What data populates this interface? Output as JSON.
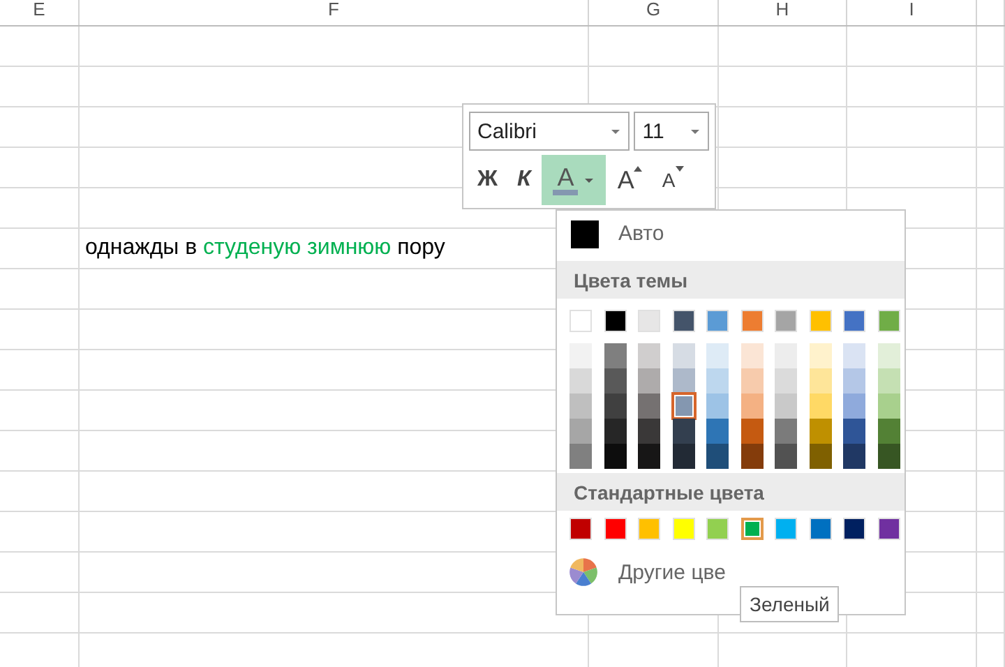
{
  "columns": [
    "E",
    "F",
    "G",
    "H",
    "I",
    ""
  ],
  "cell_text": [
    {
      "text": "однажды в ",
      "color": "#000000"
    },
    {
      "text": "студеную зимнюю",
      "color": "#00b050"
    },
    {
      "text": " пору",
      "color": "#000000"
    }
  ],
  "mini_toolbar": {
    "font": "Calibri",
    "size": "11",
    "bold": "Ж",
    "italic": "К",
    "font_color": {
      "glyph": "A",
      "color": "#8497b0",
      "selected": true
    },
    "grow": "A",
    "shrink": "A"
  },
  "color_menu": {
    "auto": {
      "label": "Авто",
      "color": "#000000"
    },
    "theme_heading": "Цвета темы",
    "theme_top": [
      {
        "color": "#ffffff",
        "selected": false
      },
      {
        "color": "#000000",
        "selected": false
      },
      {
        "color": "#e7e6e6",
        "selected": false
      },
      {
        "color": "#44546a",
        "selected": false
      },
      {
        "color": "#5b9bd5",
        "selected": false
      },
      {
        "color": "#ed7d31",
        "selected": false
      },
      {
        "color": "#a5a5a5",
        "selected": false
      },
      {
        "color": "#ffc000",
        "selected": false
      },
      {
        "color": "#4472c4",
        "selected": false
      },
      {
        "color": "#70ad47",
        "selected": false
      }
    ],
    "theme_shades": [
      [
        {
          "color": "#f2f2f2",
          "selected": false
        },
        {
          "color": "#d9d9d9",
          "selected": false
        },
        {
          "color": "#bfbfbf",
          "selected": false
        },
        {
          "color": "#a6a6a6",
          "selected": false
        },
        {
          "color": "#808080",
          "selected": false
        }
      ],
      [
        {
          "color": "#7f7f7f",
          "selected": false
        },
        {
          "color": "#595959",
          "selected": false
        },
        {
          "color": "#404040",
          "selected": false
        },
        {
          "color": "#262626",
          "selected": false
        },
        {
          "color": "#0d0d0d",
          "selected": false
        }
      ],
      [
        {
          "color": "#d0cece",
          "selected": false
        },
        {
          "color": "#aeabab",
          "selected": false
        },
        {
          "color": "#757171",
          "selected": false
        },
        {
          "color": "#3a3838",
          "selected": false
        },
        {
          "color": "#171616",
          "selected": false
        }
      ],
      [
        {
          "color": "#d6dce4",
          "selected": false
        },
        {
          "color": "#adb9ca",
          "selected": false
        },
        {
          "color": "#8497b0",
          "selected": true
        },
        {
          "color": "#333f4f",
          "selected": false
        },
        {
          "color": "#222a35",
          "selected": false
        }
      ],
      [
        {
          "color": "#deebf6",
          "selected": false
        },
        {
          "color": "#bdd7ee",
          "selected": false
        },
        {
          "color": "#9dc3e6",
          "selected": false
        },
        {
          "color": "#2e75b5",
          "selected": false
        },
        {
          "color": "#1f4e79",
          "selected": false
        }
      ],
      [
        {
          "color": "#fbe5d5",
          "selected": false
        },
        {
          "color": "#f7cbac",
          "selected": false
        },
        {
          "color": "#f4b183",
          "selected": false
        },
        {
          "color": "#c55a11",
          "selected": false
        },
        {
          "color": "#843c0b",
          "selected": false
        }
      ],
      [
        {
          "color": "#ededed",
          "selected": false
        },
        {
          "color": "#dbdbdb",
          "selected": false
        },
        {
          "color": "#c9c9c9",
          "selected": false
        },
        {
          "color": "#7b7b7b",
          "selected": false
        },
        {
          "color": "#525252",
          "selected": false
        }
      ],
      [
        {
          "color": "#fff2cc",
          "selected": false
        },
        {
          "color": "#fee599",
          "selected": false
        },
        {
          "color": "#ffd965",
          "selected": false
        },
        {
          "color": "#bf9000",
          "selected": false
        },
        {
          "color": "#7f6000",
          "selected": false
        }
      ],
      [
        {
          "color": "#dae3f3",
          "selected": false
        },
        {
          "color": "#b4c7e7",
          "selected": false
        },
        {
          "color": "#8faadc",
          "selected": false
        },
        {
          "color": "#2f5597",
          "selected": false
        },
        {
          "color": "#203864",
          "selected": false
        }
      ],
      [
        {
          "color": "#e2efd9",
          "selected": false
        },
        {
          "color": "#c5e0b3",
          "selected": false
        },
        {
          "color": "#a8d08d",
          "selected": false
        },
        {
          "color": "#538135",
          "selected": false
        },
        {
          "color": "#375623",
          "selected": false
        }
      ]
    ],
    "standard_heading": "Стандартные цвета",
    "standard": [
      {
        "color": "#c00000",
        "selected": false
      },
      {
        "color": "#ff0000",
        "selected": false
      },
      {
        "color": "#ffc000",
        "selected": false
      },
      {
        "color": "#ffff00",
        "selected": false
      },
      {
        "color": "#92d050",
        "selected": false
      },
      {
        "color": "#00b050",
        "selected": true
      },
      {
        "color": "#00b0f0",
        "selected": false
      },
      {
        "color": "#0070c0",
        "selected": false
      },
      {
        "color": "#002060",
        "selected": false
      },
      {
        "color": "#7030a0",
        "selected": false
      }
    ],
    "more": "Другие цве"
  },
  "tooltip": "Зеленый"
}
